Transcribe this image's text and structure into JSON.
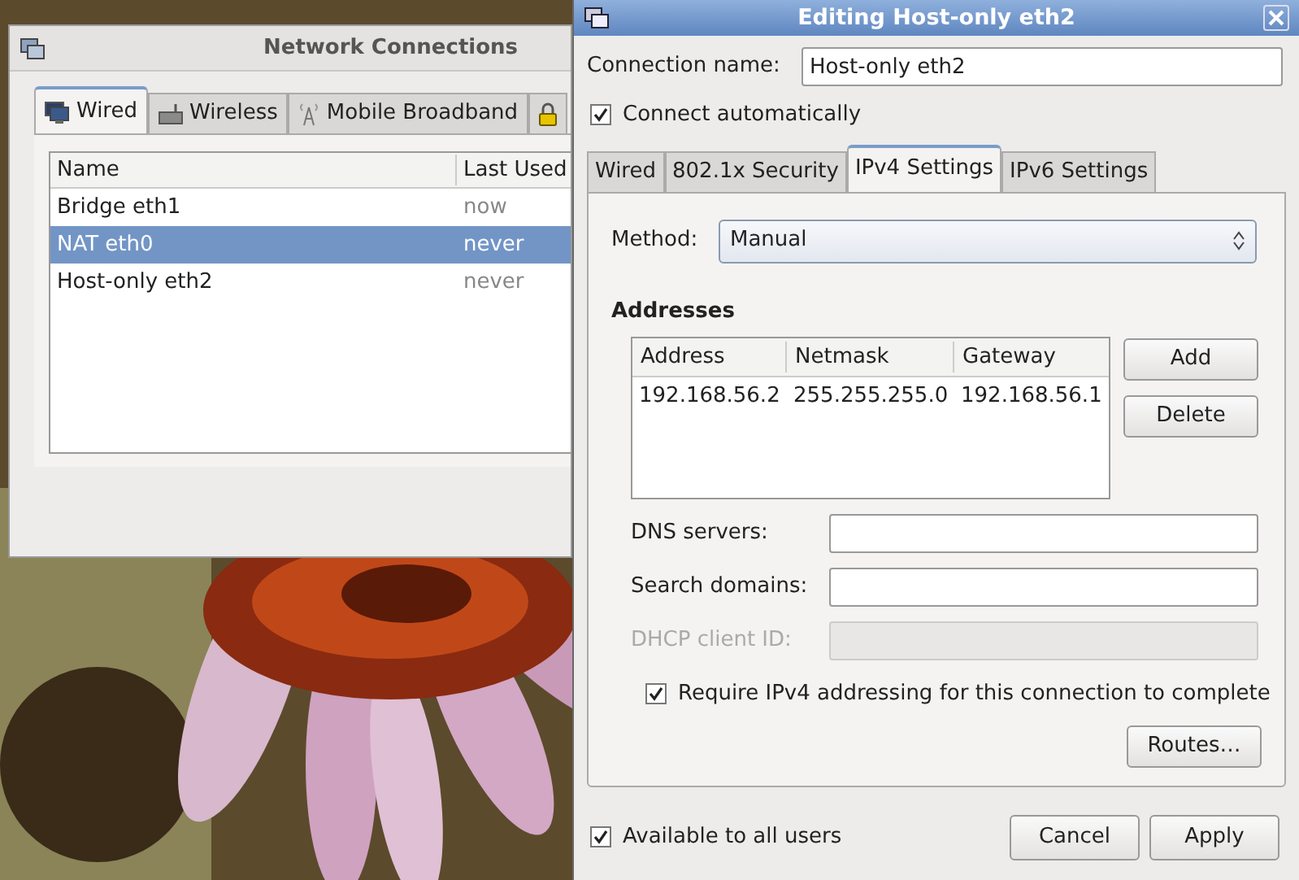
{
  "network_connections": {
    "title": "Network Connections",
    "tabs": [
      {
        "kind": "wired",
        "label": "Wired",
        "selected": true
      },
      {
        "kind": "wireless",
        "label": "Wireless",
        "selected": false
      },
      {
        "kind": "mobile",
        "label": "Mobile Broadband",
        "selected": false
      },
      {
        "kind": "vpn",
        "selected": false
      }
    ],
    "table": {
      "columns": [
        "Name",
        "Last Used"
      ],
      "rows": [
        {
          "name": "Bridge eth1",
          "last_used": "now",
          "selected": false
        },
        {
          "name": "NAT eth0",
          "last_used": "never",
          "selected": true
        },
        {
          "name": "Host-only eth2",
          "last_used": "never",
          "selected": false
        }
      ]
    }
  },
  "editor": {
    "title": "Editing Host-only eth2",
    "connection_name": {
      "label": "Connection name:",
      "value": "Host-only eth2"
    },
    "connect_automatically": {
      "label": "Connect automatically",
      "checked": true
    },
    "tabs": [
      {
        "label": "Wired",
        "selected": false
      },
      {
        "label": "802.1x Security",
        "selected": false
      },
      {
        "label": "IPv4 Settings",
        "selected": true
      },
      {
        "label": "IPv6 Settings",
        "selected": false
      }
    ],
    "method": {
      "label": "Method:",
      "value": "Manual"
    },
    "addresses": {
      "heading": "Addresses",
      "columns": [
        "Address",
        "Netmask",
        "Gateway"
      ],
      "rows": [
        {
          "address": "192.168.56.2",
          "netmask": "255.255.255.0",
          "gateway": "192.168.56.1"
        }
      ],
      "buttons": [
        "Add",
        "Delete"
      ]
    },
    "fields": [
      {
        "label": "DNS servers:",
        "disabled": false
      },
      {
        "label": "Search domains:",
        "disabled": false
      },
      {
        "label": "DHCP client ID:",
        "disabled": true
      }
    ],
    "require_ipv4": {
      "label": "Require IPv4 addressing for this connection to complete",
      "checked": true
    },
    "routes_button": "Routes…",
    "available_to_all": {
      "label": "Available to all users",
      "checked": true
    },
    "buttons": [
      "Cancel",
      "Apply"
    ]
  }
}
